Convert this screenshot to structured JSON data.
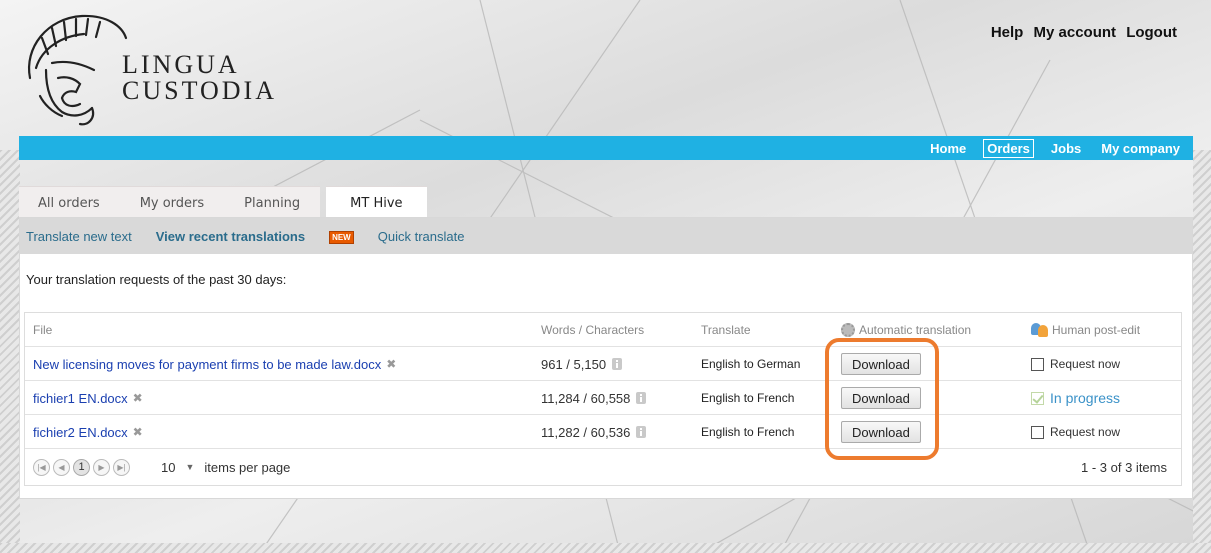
{
  "brand": {
    "line1": "LINGUA",
    "line2": "CUSTODIA"
  },
  "top_links": {
    "help": "Help",
    "account": "My account",
    "logout": "Logout"
  },
  "nav": {
    "home": "Home",
    "orders": "Orders",
    "jobs": "Jobs",
    "company": "My company",
    "active": "Orders"
  },
  "tabs": [
    "All orders",
    "My orders",
    "Planning",
    "MT Hive"
  ],
  "active_tab": "MT Hive",
  "subnav": {
    "translate_new": "Translate new text",
    "view_recent": "View recent translations",
    "new_badge": "NEW",
    "quick": "Quick translate"
  },
  "intro": "Your translation requests of the past 30 days:",
  "table": {
    "headers": {
      "file": "File",
      "words": "Words / Characters",
      "translate": "Translate",
      "auto": "Automatic translation",
      "human": "Human post-edit"
    },
    "rows": [
      {
        "file": "New licensing moves for payment firms to be made law.docx",
        "words": "961 / 5,150",
        "translate": "English to German",
        "auto_button": "Download",
        "human": "Request now",
        "human_state": "unchecked"
      },
      {
        "file": "fichier1 EN.docx",
        "words": "11,284 / 60,558",
        "translate": "English to French",
        "auto_button": "Download",
        "human": "In progress",
        "human_state": "in-progress"
      },
      {
        "file": "fichier2 EN.docx",
        "words": "11,282 / 60,536",
        "translate": "English to French",
        "auto_button": "Download",
        "human": "Request now",
        "human_state": "unchecked"
      }
    ]
  },
  "pager": {
    "current_page": "1",
    "page_size": "10",
    "items_per_page": "items per page",
    "count": "1 - 3 of 3 items"
  },
  "colors": {
    "accent": "#1fb1e3",
    "highlight": "#ed7b2e",
    "link": "#1a3fb0"
  }
}
